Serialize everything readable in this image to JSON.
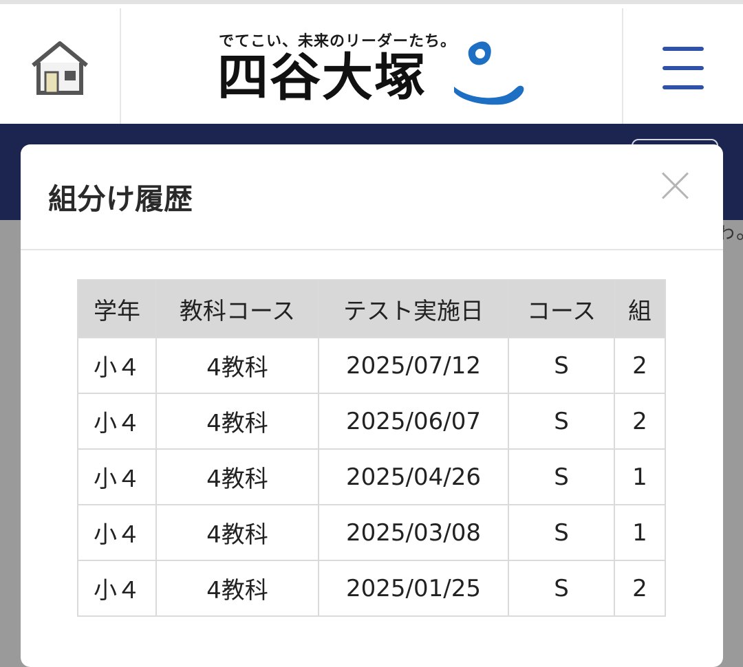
{
  "header": {
    "tagline": "でてこい、未来のリーダーたち。",
    "brand": "四谷大塚",
    "home_icon": "house-icon",
    "menu_icon": "hamburger-menu-icon",
    "brand_mark_icon": "brand-mascot-mark",
    "colors": {
      "menu": "#2f52a8",
      "mark": "#1d6fc4",
      "navy": "#1c2450"
    }
  },
  "modal": {
    "title": "組分け履歴",
    "close_icon": "close-icon"
  },
  "table": {
    "headers": [
      "学年",
      "教科コース",
      "テスト実施日",
      "コース",
      "組"
    ],
    "rows": [
      [
        "小４",
        "4教科",
        "2025/07/12",
        "S",
        "2"
      ],
      [
        "小４",
        "4教科",
        "2025/06/07",
        "S",
        "2"
      ],
      [
        "小４",
        "4教科",
        "2025/04/26",
        "S",
        "1"
      ],
      [
        "小４",
        "4教科",
        "2025/03/08",
        "S",
        "1"
      ],
      [
        "小４",
        "4教科",
        "2025/01/25",
        "S",
        "2"
      ]
    ]
  },
  "background": {
    "partial_text": "ゎ。"
  }
}
